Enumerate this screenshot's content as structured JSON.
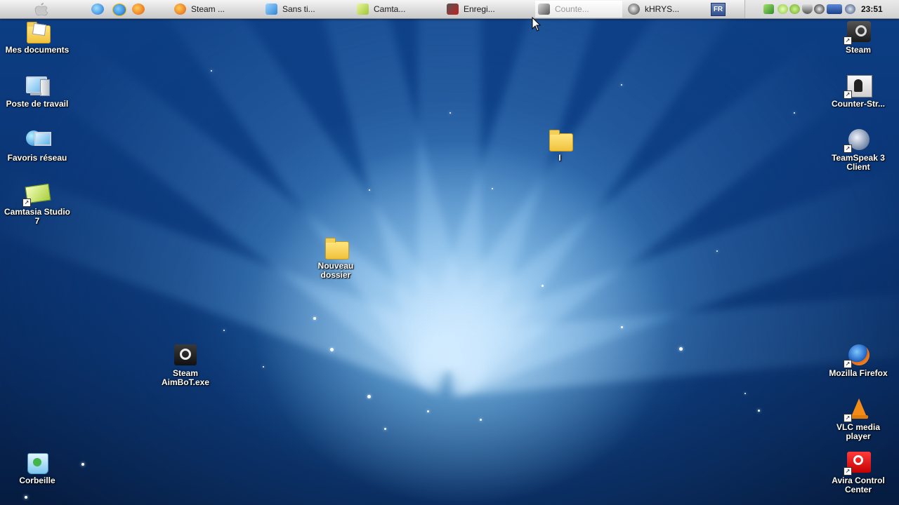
{
  "taskbar": {
    "tasks": [
      {
        "label": "Steam ...",
        "icon": "firefox-icon"
      },
      {
        "label": "Sans ti...",
        "icon": "paint-icon"
      },
      {
        "label": "Camta...",
        "icon": "camtasia-icon"
      },
      {
        "label": "Enregi...",
        "icon": "recorder-icon"
      },
      {
        "label": "Counte...",
        "icon": "counter-strike-icon"
      },
      {
        "label": "kHRYS...",
        "icon": "steam-icon"
      }
    ],
    "language": "FR",
    "clock": "23:51"
  },
  "desktop_left": [
    {
      "label": "Mes documents"
    },
    {
      "label": "Poste de travail"
    },
    {
      "label": "Favoris réseau"
    },
    {
      "label": "Camtasia Studio 7"
    }
  ],
  "desktop_right": [
    {
      "label": "Steam"
    },
    {
      "label": "Counter-Str..."
    },
    {
      "label": "TeamSpeak 3 Client"
    },
    {
      "label": "Mozilla Firefox"
    },
    {
      "label": "VLC media player"
    },
    {
      "label": "Avira Control Center"
    }
  ],
  "desktop_misc": {
    "folder_i": "I",
    "nouveau_dossier": "Nouveau dossier",
    "steam_aimbot": "Steam AimBoT.exe",
    "corbeille": "Corbeille"
  },
  "colors": {
    "desktop": "#0a3575",
    "taskbar": "#dcdcdc"
  }
}
